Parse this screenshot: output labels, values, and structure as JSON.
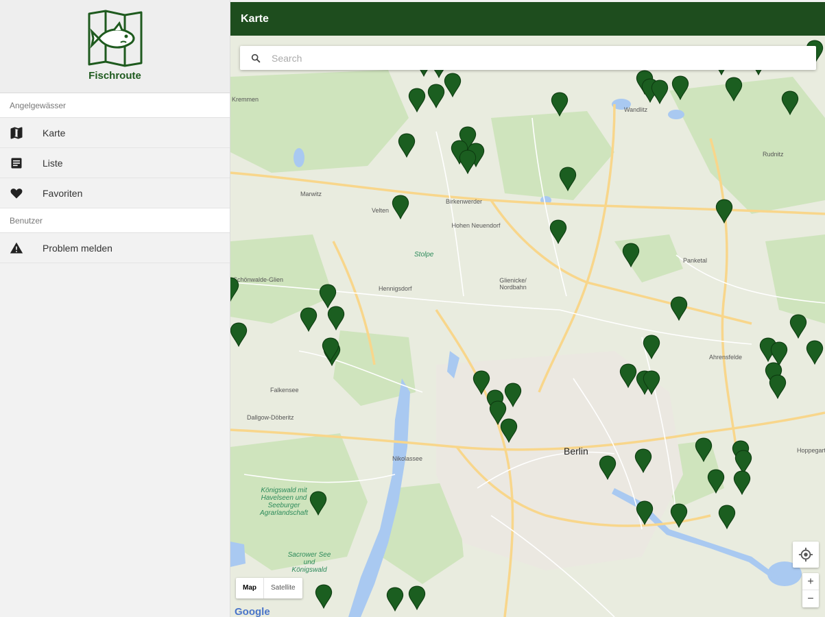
{
  "brand": {
    "name": "Fischroute",
    "logo_icon": "fish-map-icon",
    "color": "#1e5a1e"
  },
  "sidebar": {
    "section1": "Angelgewässer",
    "items": [
      {
        "label": "Karte",
        "icon": "map-icon"
      },
      {
        "label": "Liste",
        "icon": "list-icon"
      },
      {
        "label": "Favoriten",
        "icon": "heart-icon"
      }
    ],
    "section2": "Benutzer",
    "items2": [
      {
        "label": "Problem melden",
        "icon": "warning-icon"
      }
    ]
  },
  "header": {
    "title": "Karte",
    "color": "#1e4d1e"
  },
  "search": {
    "placeholder": "Search"
  },
  "map": {
    "type_options": [
      "Map",
      "Satellite"
    ],
    "selected_type": "Map",
    "zoom_in": "+",
    "zoom_out": "−",
    "provider": "Google",
    "marker_color": "#1b5e20",
    "places": {
      "berlin": "Berlin",
      "panketal": "Panketal",
      "falkensee": "Falkensee",
      "hennigsdorf": "Hennigsdorf",
      "marwitz": "Marwitz",
      "velten": "Velten",
      "birkenwerder": "Birkenwerder",
      "hohen_neuendorf": "Hohen Neuendorf",
      "glienicke": "Glienicke/ Nordbahn",
      "schoenwalde": "Schönwalde-Glien",
      "dallgow": "Dallgow-Döberitz",
      "nikolassee": "Nikolassee",
      "koenigswald": "Königswald mit Havelseen und Seeburger Agrarlandschaft",
      "sacrower": "Sacrower See und Königswald",
      "ahrensfelde": "Ahrensfelde",
      "kremmen": "Kremmen",
      "wandlitz": "Wandlitz",
      "hoppegarten": "Hoppegarten",
      "rudnitz": "Rudnitz",
      "stolpe": "Stolpe"
    }
  }
}
